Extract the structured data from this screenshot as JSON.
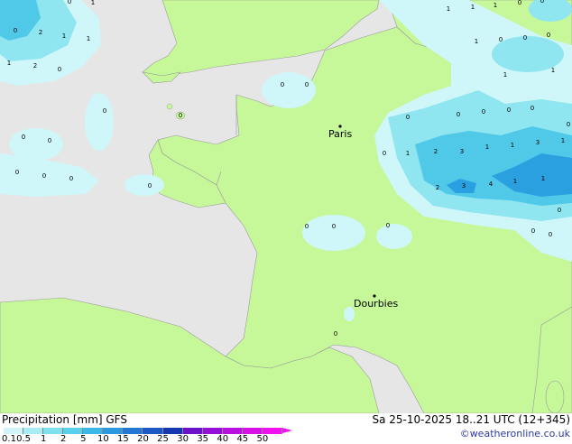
{
  "map": {
    "cities": [
      {
        "name": "Paris"
      },
      {
        "name": "Dourbies"
      }
    ],
    "value_labels": [
      "0",
      "2",
      "1",
      "1",
      "0",
      "1",
      "1",
      "2",
      "0",
      "1",
      "1",
      "0",
      "0",
      "1",
      "1",
      "0",
      "0",
      "0",
      "1",
      "1",
      "0",
      "0",
      "0",
      "0",
      "0",
      "0",
      "0",
      "0",
      "0",
      "0",
      "0",
      "0",
      "0",
      "0",
      "0",
      "0",
      "0",
      "0",
      "0",
      "1",
      "2",
      "3",
      "2",
      "3",
      "4",
      "1",
      "1",
      "1",
      "1",
      "3",
      "1",
      "0",
      "0",
      "0",
      "0",
      "0"
    ],
    "colors": {
      "land": "#c6f89a",
      "sea": "#e6e6e6",
      "precip_light": "#cff6f8",
      "precip_mid": "#8fe6f0",
      "precip_heavy": "#50c8e8",
      "precip_max": "#2aa0e0"
    }
  },
  "footer": {
    "title_left": "Precipitation [mm] GFS",
    "title_right": "Sa 25-10-2025 18..21 UTC (12+345)",
    "copyright": "©weatheronline.co.uk"
  },
  "legend": {
    "ticks": [
      "0.1",
      "0.5",
      "1",
      "2",
      "5",
      "10",
      "15",
      "20",
      "25",
      "30",
      "35",
      "40",
      "45",
      "50"
    ],
    "colors": [
      "#d0f4f8",
      "#a8ecf4",
      "#80e0f0",
      "#58d0ec",
      "#3cb8e8",
      "#2c98e0",
      "#2478d4",
      "#1c58c4",
      "#1438b0",
      "#6a10c8",
      "#9410d8",
      "#b810e0",
      "#d810e8",
      "#f010f0"
    ]
  }
}
